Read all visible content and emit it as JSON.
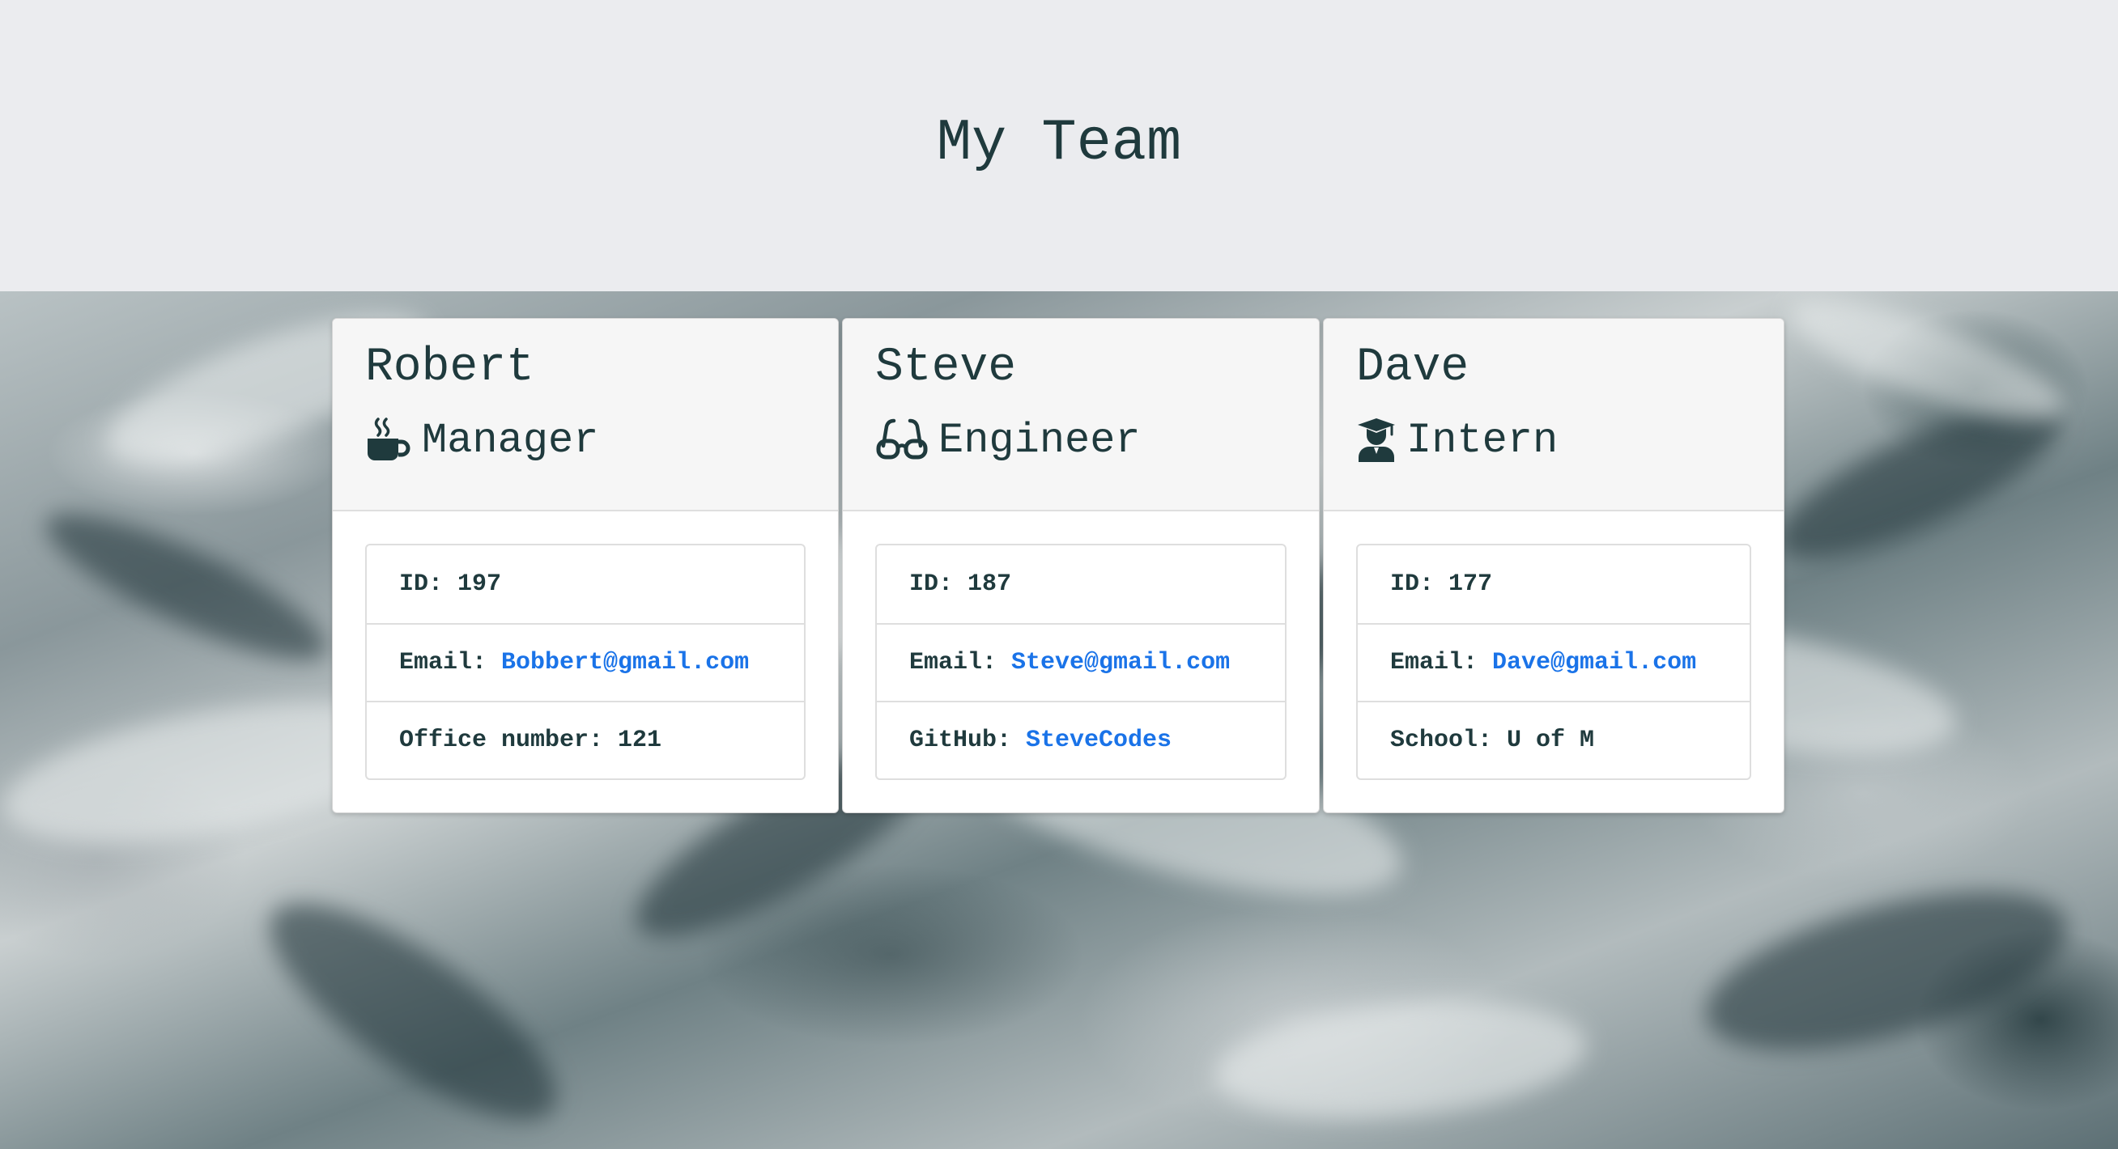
{
  "header": {
    "title": "My Team"
  },
  "team": [
    {
      "name": "Robert",
      "role": "Manager",
      "icon": "coffee-mug-icon",
      "id_label": "ID: ",
      "id": "197",
      "email_label": "Email: ",
      "email": "Bobbert@gmail.com",
      "extra_label": "Office number: ",
      "extra_value": "121"
    },
    {
      "name": "Steve",
      "role": "Engineer",
      "icon": "glasses-icon",
      "id_label": "ID: ",
      "id": "187",
      "email_label": "Email: ",
      "email": "Steve@gmail.com",
      "extra_label": "GitHub: ",
      "extra_value": "SteveCodes"
    },
    {
      "name": "Dave",
      "role": "Intern",
      "icon": "graduate-icon",
      "id_label": "ID: ",
      "id": "177",
      "email_label": "Email: ",
      "email": "Dave@gmail.com",
      "extra_label": "School: ",
      "extra_value": "U of M"
    }
  ],
  "colors": {
    "text": "#1f3a3d",
    "link": "#1a73e8",
    "header_bg": "#ebecef",
    "card_header_bg": "#f6f6f6"
  }
}
